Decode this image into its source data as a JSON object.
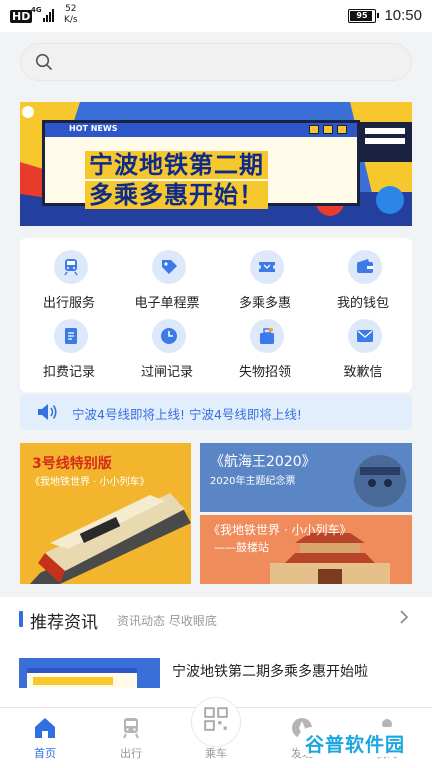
{
  "status_bar": {
    "hd": "HD",
    "network": "4G",
    "speed_value": "52",
    "speed_unit": "K/s",
    "battery": "95",
    "time": "10:50"
  },
  "search": {
    "placeholder": ""
  },
  "banner": {
    "tag": "HOT NEWS",
    "line1": "宁波地铁第二期",
    "line2": "多乘多惠开始！"
  },
  "quick_menu": [
    {
      "label": "出行服务",
      "icon": "train-icon"
    },
    {
      "label": "电子单程票",
      "icon": "ticket-tag-icon"
    },
    {
      "label": "多乘多惠",
      "icon": "coupon-icon"
    },
    {
      "label": "我的钱包",
      "icon": "wallet-icon"
    },
    {
      "label": "扣费记录",
      "icon": "document-icon"
    },
    {
      "label": "过闸记录",
      "icon": "clock-icon"
    },
    {
      "label": "失物招领",
      "icon": "lost-found-icon"
    },
    {
      "label": "致歉信",
      "icon": "mail-icon"
    }
  ],
  "notice": {
    "text": "宁波4号线即将上线! 宁波4号线即将上线!"
  },
  "promos": {
    "left": {
      "title": "3号线特别版",
      "subtitle": "《我地铁世界 · 小小列车》"
    },
    "right_top": {
      "title": "《航海王2020》",
      "subtitle": "2020年主题纪念票"
    },
    "right_bottom": {
      "title": "《我地铁世界 · 小小列车》",
      "subtitle": "——鼓楼站"
    }
  },
  "news": {
    "title": "推荐资讯",
    "subtitle": "资讯动态 尽收眼底",
    "items": [
      {
        "title": "宁波地铁第二期多乘多惠开始啦"
      }
    ]
  },
  "tabs": [
    {
      "label": "首页",
      "icon": "home-icon",
      "active": true
    },
    {
      "label": "出行",
      "icon": "metro-icon",
      "active": false
    },
    {
      "label": "乘车",
      "icon": "qr-code-icon",
      "active": false
    },
    {
      "label": "发现",
      "icon": "discover-icon",
      "active": false
    },
    {
      "label": "我的",
      "icon": "profile-icon",
      "active": false
    }
  ],
  "watermark": "谷普软件园",
  "colors": {
    "accent": "#2f6fe0",
    "notice_bg": "#e3eefc",
    "banner_yellow": "#f7c82e"
  }
}
